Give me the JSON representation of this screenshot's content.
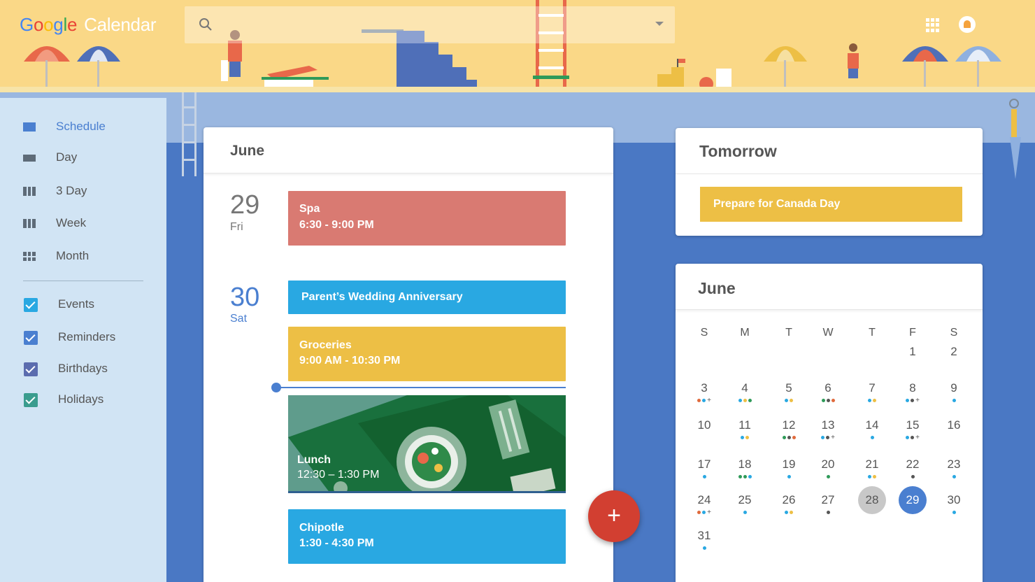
{
  "app": {
    "logo_google": [
      "G",
      "o",
      "o",
      "g",
      "l",
      "e"
    ],
    "logo_product": "Calendar"
  },
  "colors": {
    "header_bg": "#fad887",
    "sidebar_bg": "#d1e4f4",
    "water": "#4a78c4",
    "accent_blue": "#4a7fd0",
    "event_red": "#d97a72",
    "event_cyan": "#29a8e2",
    "event_yellow": "#edbf45",
    "fab_red": "#d23f31"
  },
  "search": {
    "icon": "search-icon",
    "dropdown_icon": "caret-down-icon"
  },
  "header_icons": [
    "apps-grid-icon",
    "notifications-bell-icon"
  ],
  "sidebar": {
    "views": [
      {
        "label": "Schedule",
        "icon": "schedule-icon",
        "active": true
      },
      {
        "label": "Day",
        "icon": "day-icon",
        "active": false
      },
      {
        "label": "3 Day",
        "icon": "three-day-icon",
        "active": false
      },
      {
        "label": "Week",
        "icon": "week-icon",
        "active": false
      },
      {
        "label": "Month",
        "icon": "month-icon",
        "active": false
      }
    ],
    "calendars": [
      {
        "label": "Events",
        "checked": true,
        "color": "#29a8e2"
      },
      {
        "label": "Reminders",
        "checked": true,
        "color": "#4a7fd0"
      },
      {
        "label": "Birthdays",
        "checked": true,
        "color": "#5b6cae"
      },
      {
        "label": "Holidays",
        "checked": true,
        "color": "#3a9c8e"
      }
    ]
  },
  "schedule": {
    "title": "June",
    "days": [
      {
        "num": "29",
        "dow": "Fri",
        "today": false
      },
      {
        "num": "30",
        "dow": "Sat",
        "today": true
      }
    ],
    "events": [
      {
        "title": "Spa",
        "time": "6:30 - 9:00 PM",
        "color": "#d97a72"
      },
      {
        "title": "Parent’s Wedding Anniversary",
        "time": "",
        "color": "#29a8e2"
      },
      {
        "title": "Groceries",
        "time": "9:00 AM - 10:30 PM",
        "color": "#edbf45"
      },
      {
        "title": "Lunch",
        "time": "12:30 – 1:30 PM",
        "color": "#5f9c8c"
      },
      {
        "title": "Chipotle",
        "time": "1:30 - 4:30 PM",
        "color": "#29a8e2"
      }
    ]
  },
  "fab": {
    "label": "+"
  },
  "tomorrow": {
    "title": "Tomorrow",
    "event": {
      "title": "Prepare for Canada Day",
      "color": "#edbf45"
    }
  },
  "mini_month": {
    "title": "June",
    "weekdays": [
      "S",
      "M",
      "T",
      "W",
      "T",
      "F",
      "S"
    ],
    "selected_day": "29",
    "today_day": "28",
    "weeks": [
      [
        null,
        null,
        null,
        null,
        null,
        {
          "d": "1",
          "dots": []
        },
        {
          "d": "2",
          "dots": []
        }
      ],
      [
        {
          "d": "3",
          "dots": [
            "#e06a3c",
            "#29a8e2",
            "+"
          ]
        },
        {
          "d": "4",
          "dots": [
            "#29a8e2",
            "#edbf45",
            "#2f9a59"
          ]
        },
        {
          "d": "5",
          "dots": [
            "#29a8e2",
            "#edbf45"
          ]
        },
        {
          "d": "6",
          "dots": [
            "#2f9a59",
            "#555555",
            "#e06a3c"
          ]
        },
        {
          "d": "7",
          "dots": [
            "#29a8e2",
            "#edbf45"
          ]
        },
        {
          "d": "8",
          "dots": [
            "#29a8e2",
            "#555555",
            "+"
          ]
        },
        {
          "d": "9",
          "dots": [
            "#29a8e2"
          ]
        }
      ],
      [
        {
          "d": "10",
          "dots": []
        },
        {
          "d": "11",
          "dots": [
            "#29a8e2",
            "#edbf45"
          ]
        },
        {
          "d": "12",
          "dots": [
            "#2f9a59",
            "#555555",
            "#e06a3c"
          ]
        },
        {
          "d": "13",
          "dots": [
            "#29a8e2",
            "#555555",
            "+"
          ]
        },
        {
          "d": "14",
          "dots": [
            "#29a8e2"
          ]
        },
        {
          "d": "15",
          "dots": [
            "#29a8e2",
            "#555555",
            "+"
          ]
        },
        {
          "d": "16",
          "dots": []
        }
      ],
      [
        {
          "d": "17",
          "dots": [
            "#29a8e2"
          ]
        },
        {
          "d": "18",
          "dots": [
            "#2f9a59",
            "#2f9a59",
            "#29a8e2"
          ]
        },
        {
          "d": "19",
          "dots": [
            "#29a8e2"
          ]
        },
        {
          "d": "20",
          "dots": [
            "#2f9a59"
          ]
        },
        {
          "d": "21",
          "dots": [
            "#29a8e2",
            "#edbf45"
          ]
        },
        {
          "d": "22",
          "dots": [
            "#555555"
          ]
        },
        {
          "d": "23",
          "dots": [
            "#29a8e2"
          ]
        }
      ],
      [
        {
          "d": "24",
          "dots": [
            "#e06a3c",
            "#29a8e2",
            "+"
          ]
        },
        {
          "d": "25",
          "dots": [
            "#29a8e2"
          ]
        },
        {
          "d": "26",
          "dots": [
            "#29a8e2",
            "#edbf45"
          ]
        },
        {
          "d": "27",
          "dots": [
            "#555555"
          ]
        },
        {
          "d": "28",
          "dots": []
        },
        {
          "d": "29",
          "dots": []
        },
        {
          "d": "30",
          "dots": [
            "#29a8e2"
          ]
        }
      ],
      [
        {
          "d": "31",
          "dots": [
            "#29a8e2"
          ]
        },
        null,
        null,
        null,
        null,
        null,
        null
      ]
    ]
  }
}
